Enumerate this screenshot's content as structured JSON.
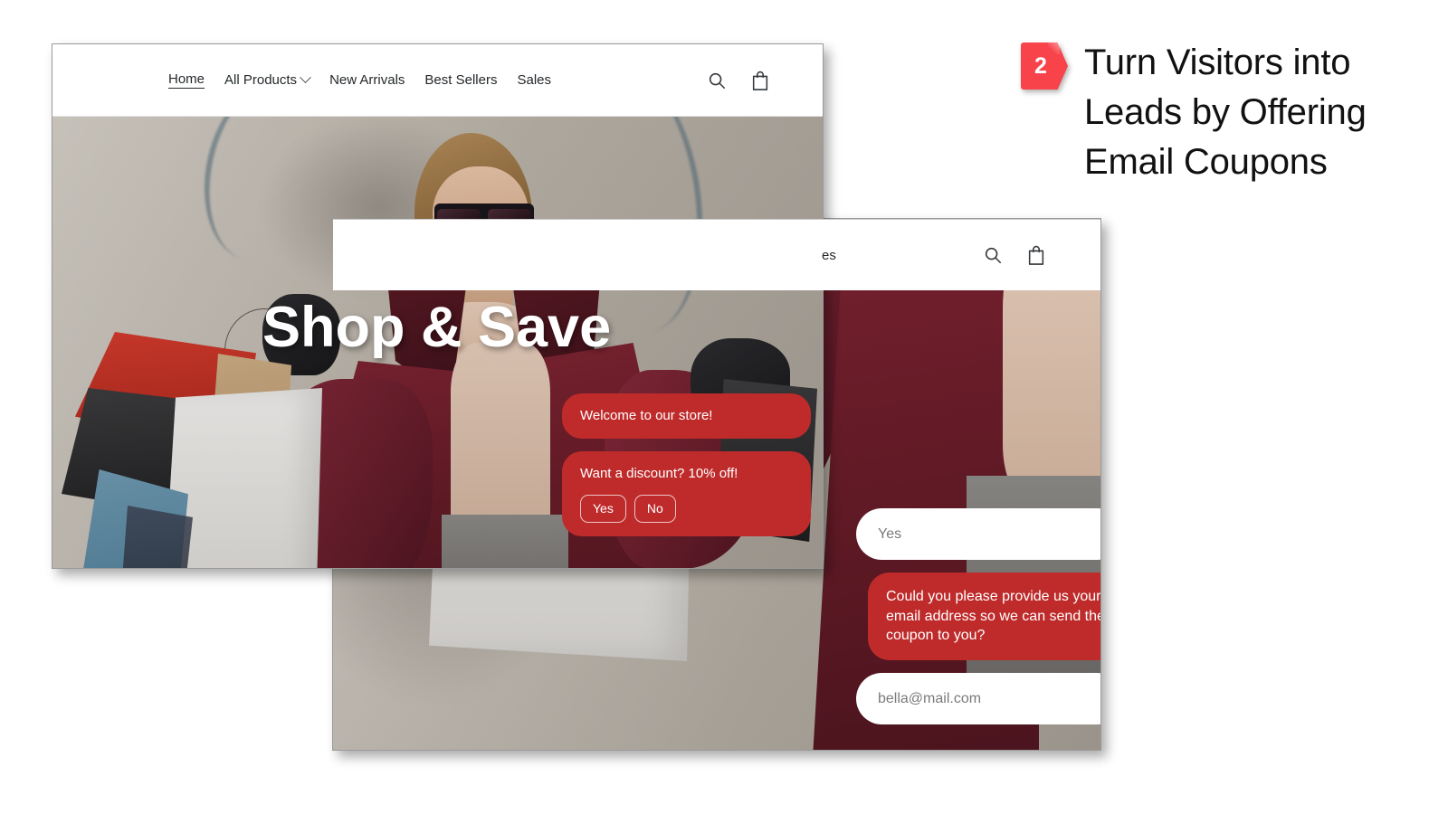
{
  "callout": {
    "badge_number": "2",
    "badge_color": "#f8434a",
    "title": "Turn Visitors into Leads by Offering Email Coupons"
  },
  "theme": {
    "chat_bubble_red": "#bf2b2b",
    "user_bubble_white": "#ffffff",
    "user_bubble_text": "#7a7a7a",
    "nav_text": "#24282b",
    "hero_title_color": "#ffffff"
  },
  "window_back": {
    "nav": {
      "partial_link": "es",
      "icons": [
        "search-icon",
        "shopping-bag-icon"
      ]
    },
    "chat": {
      "messages": [
        {
          "sender": "user",
          "text": "Yes"
        },
        {
          "sender": "bot",
          "text": "Could you please provide us your email address so we can send the coupon to you?"
        },
        {
          "sender": "user",
          "text": "bella@mail.com"
        }
      ]
    }
  },
  "window_front": {
    "nav": {
      "links": [
        {
          "label": "Home",
          "active": true,
          "has_chevron": false
        },
        {
          "label": "All Products",
          "active": false,
          "has_chevron": true
        },
        {
          "label": "New Arrivals",
          "active": false,
          "has_chevron": false
        },
        {
          "label": "Best Sellers",
          "active": false,
          "has_chevron": false
        },
        {
          "label": "Sales",
          "active": false,
          "has_chevron": false
        }
      ],
      "icons": [
        "search-icon",
        "shopping-bag-icon"
      ]
    },
    "hero": {
      "title": "Shop & Save"
    },
    "chat": {
      "messages": [
        {
          "sender": "bot",
          "text": "Welcome to our store!"
        },
        {
          "sender": "bot",
          "text": "Want a discount? 10% off!",
          "quick_replies": [
            "Yes",
            "No"
          ]
        }
      ],
      "quick_reply_yes": "Yes",
      "quick_reply_no": "No"
    }
  }
}
